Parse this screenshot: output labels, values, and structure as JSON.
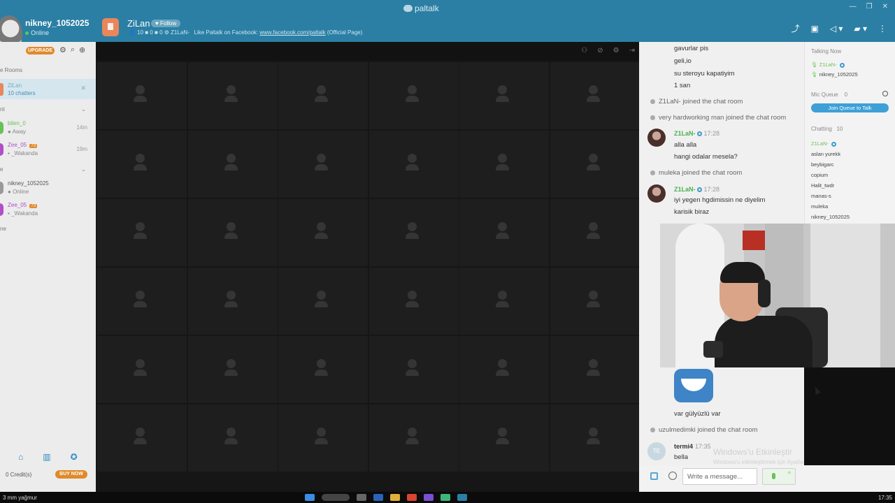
{
  "app": {
    "brand": "paltalk",
    "window_controls": [
      "—",
      "❐",
      "✕"
    ]
  },
  "user": {
    "name": "nikney_1052025",
    "status": "Online"
  },
  "room": {
    "name": "ZiLan",
    "follow_label": "Follow",
    "meta_stats": "👤 10  ■ 0  ■ 0  ⚙ Z1LaN-",
    "facebook_text": "Like Paltalk on Facebook:",
    "facebook_link": "www.facebook.com/paltalk",
    "facebook_suffix": "(Official Page)"
  },
  "sidebar": {
    "upgrade_label": "UPGRADE",
    "rooms_header": "e Rooms",
    "active_room": {
      "name": "ZiLan",
      "chatters": "10 chatters",
      "close": "✕"
    },
    "section_1": "nt",
    "section_2": "e",
    "section_3": "ne",
    "contacts_1": [
      {
        "name": "bilen_0",
        "status": "Away",
        "time": "14m",
        "color": "#6bbf58"
      },
      {
        "name": "Zee_05",
        "badge": "73",
        "status": "_Wakanda",
        "time": "19m",
        "color": "#b04fc7"
      }
    ],
    "contacts_2": [
      {
        "name": "nikney_1052025",
        "status": "Online",
        "color": "#555"
      },
      {
        "name": "Zee_05",
        "badge": "73",
        "status": "_Wakanda",
        "color": "#b04fc7"
      }
    ],
    "credits": "0 Credit(s)",
    "buy_label": "BUY NOW"
  },
  "chat": {
    "lines_top": [
      "gavurlar pis",
      "geli,io",
      "su steroyu kapatiyim",
      "1 san"
    ],
    "sys_1": "Z1LaN- joined the chat room",
    "sys_2": "very hardworking man joined the chat room",
    "msg_1": {
      "user": "Z1LaN-",
      "time": "17:28",
      "lines": [
        "alla alla",
        "hangi odalar mesela?"
      ]
    },
    "sys_3": "muleka joined the chat room",
    "msg_2": {
      "user": "Z1LaN-",
      "time": "17:28",
      "lines": [
        "iyi yegen hgdimissin ne diyelim",
        "karisik biraz"
      ]
    },
    "emoji_caption": "var gülyüzlü var",
    "sys_4": "uzulmedimki joined the chat room",
    "msg_3": {
      "avatar": "TE",
      "user": "termi4",
      "time": "17:35",
      "line": "bella"
    },
    "input_placeholder": "Write a message..."
  },
  "watermark": {
    "line1": "Windows'u Etkinleştir",
    "line2": "Windows'u etkinleştirmek için Ayarlar'a gidin."
  },
  "users_panel": {
    "talking_label": "Talking Now",
    "talking": [
      "Z1LaN-",
      "nikney_1052025"
    ],
    "mic_queue_label": "Mic Queue",
    "mic_queue_count": "0",
    "join_queue_label": "Join Queue to Talk",
    "chatting_label": "Chatting",
    "chatting_count": "10",
    "chatting": [
      "Z1LaN-",
      "aslan yurekk",
      "beybigarc",
      "copium",
      "Halit_twdr",
      "manas-s",
      "muleka",
      "nikney_1052025"
    ]
  },
  "taskbar": {
    "weather": "3 mm yağmur",
    "time": "17:35"
  },
  "icons": [
    "share-icon",
    "gift-icon",
    "megaphone-icon",
    "cam-icon",
    "more-icon",
    "gear-icon",
    "search-icon",
    "add-user-icon",
    "home-icon",
    "chart-icon",
    "award-icon"
  ]
}
